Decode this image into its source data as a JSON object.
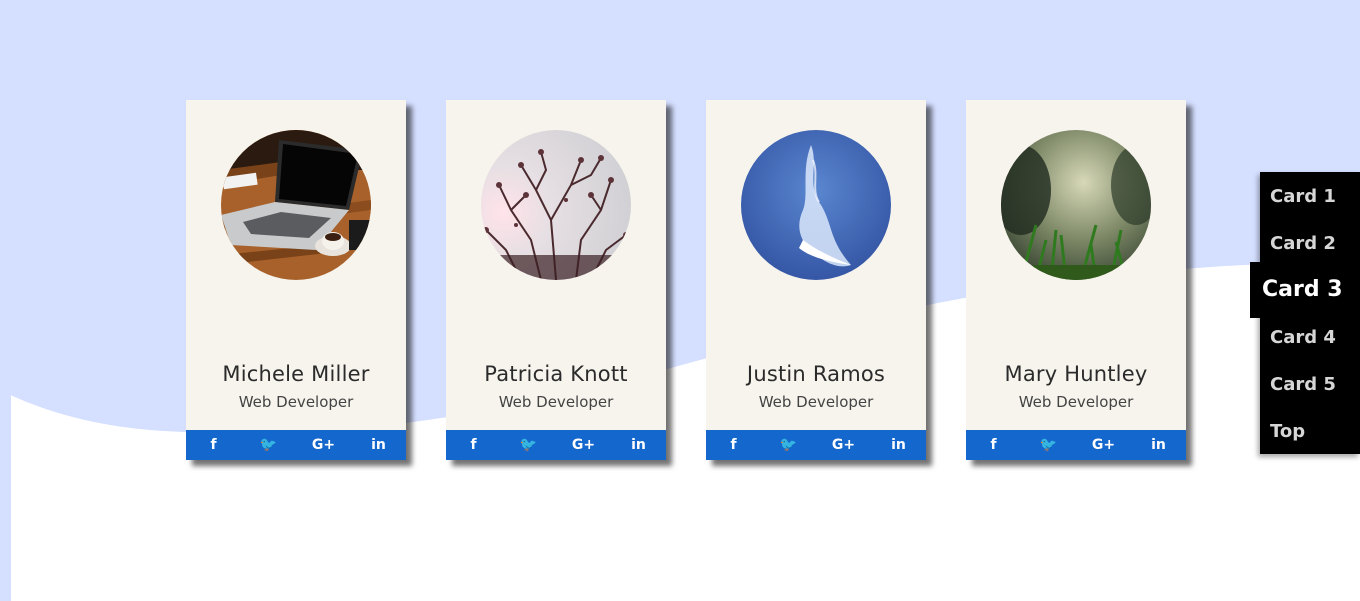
{
  "colors": {
    "background_wave": "#d5dfff",
    "card_bg": "#f7f4ed",
    "social_bar": "#1467cc",
    "nav_bg": "#000000",
    "nav_text": "#d6d6d6",
    "nav_active_text": "#ffffff"
  },
  "cards": [
    {
      "name": "Michele Miller",
      "role": "Web Developer",
      "image": "laptop-on-desk-photo"
    },
    {
      "name": "Patricia Knott",
      "role": "Web Developer",
      "image": "tree-branches-photo"
    },
    {
      "name": "Justin Ramos",
      "role": "Web Developer",
      "image": "blue-sky-cloud-photo"
    },
    {
      "name": "Mary Huntley",
      "role": "Web Developer",
      "image": "grass-closeup-photo"
    }
  ],
  "social": {
    "facebook": "f",
    "twitter": "🐦",
    "google_plus": "G+",
    "linkedin": "in"
  },
  "nav": {
    "items": [
      "Card 1",
      "Card 2",
      "Card 3",
      "Card 4",
      "Card 5",
      "Top"
    ],
    "active_index": 2
  }
}
